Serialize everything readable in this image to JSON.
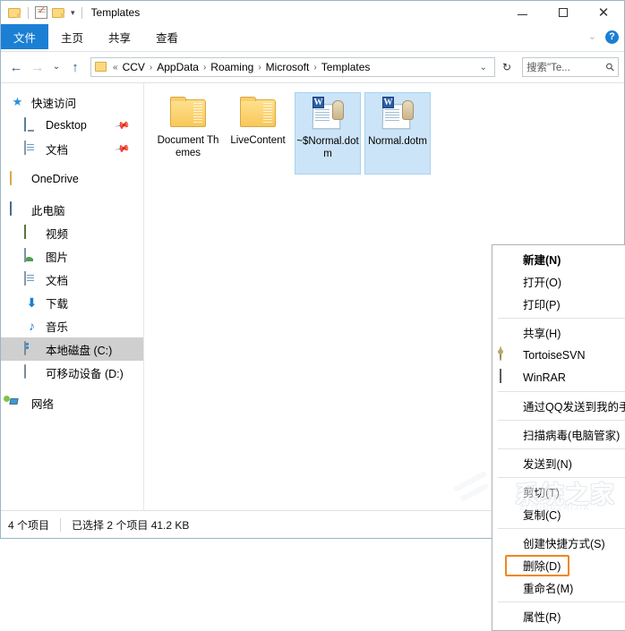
{
  "window": {
    "title": "Templates",
    "minimize_label": "—",
    "maximize_label": "□",
    "close_label": "✕"
  },
  "quick_access": {
    "folder_icon": "folder-icon",
    "properties_icon": "properties-icon",
    "new_folder_icon": "new-folder-icon",
    "dropdown_label": "▾"
  },
  "ribbon": {
    "tabs": [
      {
        "label": "文件",
        "active": true
      },
      {
        "label": "主页",
        "active": false
      },
      {
        "label": "共享",
        "active": false
      },
      {
        "label": "查看",
        "active": false
      }
    ],
    "expand_label": "⌄",
    "help_label": "?"
  },
  "address": {
    "back_label": "←",
    "forward_label": "→",
    "history_label": "⌄",
    "up_label": "↑",
    "root_label": "«",
    "crumbs": [
      "CCV",
      "AppData",
      "Roaming",
      "Microsoft",
      "Templates"
    ],
    "separator": "›",
    "dropdown_label": "⌄",
    "refresh_label": "↻"
  },
  "search": {
    "placeholder": "搜索\"Te...",
    "value": "搜索\"Te...",
    "icon": "search-icon"
  },
  "sidebar": {
    "items": [
      {
        "label": "快速访问",
        "icon": "star-icon",
        "indent": false,
        "selected": false,
        "pinned": false
      },
      {
        "label": "Desktop",
        "icon": "desktop-icon",
        "indent": true,
        "selected": false,
        "pinned": true
      },
      {
        "label": "文档",
        "icon": "document-icon",
        "indent": true,
        "selected": false,
        "pinned": true
      },
      {
        "label": "OneDrive",
        "icon": "onedrive-folder-icon",
        "indent": false,
        "selected": false,
        "pinned": false
      },
      {
        "label": "此电脑",
        "icon": "this-pc-icon",
        "indent": false,
        "selected": false,
        "pinned": false
      },
      {
        "label": "视频",
        "icon": "video-icon",
        "indent": true,
        "selected": false,
        "pinned": false
      },
      {
        "label": "图片",
        "icon": "pictures-icon",
        "indent": true,
        "selected": false,
        "pinned": false
      },
      {
        "label": "文档",
        "icon": "document-icon",
        "indent": true,
        "selected": false,
        "pinned": false
      },
      {
        "label": "下载",
        "icon": "download-icon",
        "indent": true,
        "selected": false,
        "pinned": false
      },
      {
        "label": "音乐",
        "icon": "music-icon",
        "indent": true,
        "selected": false,
        "pinned": false
      },
      {
        "label": "本地磁盘 (C:)",
        "icon": "harddisk-icon",
        "indent": true,
        "selected": true,
        "pinned": false
      },
      {
        "label": "可移动设备 (D:)",
        "icon": "removable-drive-icon",
        "indent": true,
        "selected": false,
        "pinned": false
      },
      {
        "label": "网络",
        "icon": "network-icon",
        "indent": false,
        "selected": false,
        "pinned": false
      }
    ],
    "pin_glyph": "📌"
  },
  "files": [
    {
      "name": "Document Themes",
      "type": "folder",
      "selected": false
    },
    {
      "name": "LiveContent",
      "type": "folder",
      "selected": false
    },
    {
      "name": "~$Normal.dotm",
      "type": "word-template",
      "selected": true,
      "badge": "W"
    },
    {
      "name": "Normal.dotm",
      "type": "word-template",
      "selected": true,
      "badge": "W"
    }
  ],
  "context_menu": {
    "items": [
      {
        "label": "新建(N)",
        "bold": true,
        "icon": null,
        "submenu": false,
        "highlight": false,
        "separator_after": false
      },
      {
        "label": "打开(O)",
        "bold": false,
        "icon": null,
        "submenu": false,
        "highlight": false,
        "separator_after": false
      },
      {
        "label": "打印(P)",
        "bold": false,
        "icon": null,
        "submenu": false,
        "highlight": false,
        "separator_after": true
      },
      {
        "label": "共享(H)",
        "bold": false,
        "icon": null,
        "submenu": true,
        "highlight": false,
        "separator_after": false
      },
      {
        "label": "TortoiseSVN",
        "bold": false,
        "icon": "tortoisesvn-icon",
        "submenu": true,
        "highlight": false,
        "separator_after": false
      },
      {
        "label": "WinRAR",
        "bold": false,
        "icon": "winrar-icon",
        "submenu": true,
        "highlight": false,
        "separator_after": true
      },
      {
        "label": "通过QQ发送到我的手机",
        "bold": false,
        "icon": null,
        "submenu": false,
        "highlight": false,
        "separator_after": true
      },
      {
        "label": "扫描病毒(电脑管家)",
        "bold": false,
        "icon": "shield-icon",
        "submenu": false,
        "highlight": false,
        "separator_after": true
      },
      {
        "label": "发送到(N)",
        "bold": false,
        "icon": null,
        "submenu": true,
        "highlight": false,
        "separator_after": true
      },
      {
        "label": "剪切(T)",
        "bold": false,
        "icon": null,
        "submenu": false,
        "highlight": false,
        "separator_after": false
      },
      {
        "label": "复制(C)",
        "bold": false,
        "icon": null,
        "submenu": false,
        "highlight": false,
        "separator_after": true
      },
      {
        "label": "创建快捷方式(S)",
        "bold": false,
        "icon": null,
        "submenu": false,
        "highlight": false,
        "separator_after": false
      },
      {
        "label": "删除(D)",
        "bold": false,
        "icon": null,
        "submenu": false,
        "highlight": true,
        "separator_after": false
      },
      {
        "label": "重命名(M)",
        "bold": false,
        "icon": null,
        "submenu": false,
        "highlight": false,
        "separator_after": true
      },
      {
        "label": "属性(R)",
        "bold": false,
        "icon": null,
        "submenu": false,
        "highlight": false,
        "separator_after": false
      }
    ],
    "submenu_glyph": "›",
    "highlight_color": "#ef8721"
  },
  "status": {
    "item_count": "4 个项目",
    "selection": "已选择 2 个项目  41.2 KB",
    "view_list_icon": "details-view-icon",
    "view_tiles_icon": "large-icons-view-icon"
  },
  "watermark": {
    "text": "系统之家",
    "subtext": "XITONGZHIJIA"
  },
  "colors": {
    "accent": "#1b7fd4",
    "selection": "#cce4f7",
    "highlight": "#ef8721"
  }
}
